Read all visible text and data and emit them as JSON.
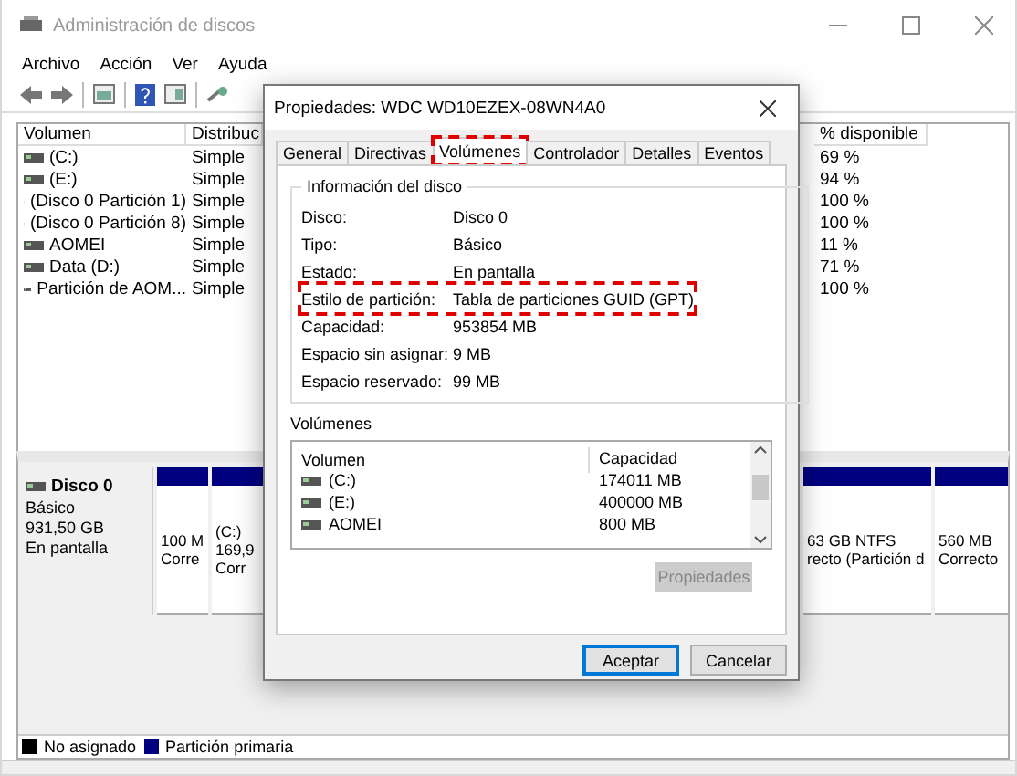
{
  "window": {
    "title": "Administración de discos"
  },
  "menu": [
    "Archivo",
    "Acción",
    "Ver",
    "Ayuda"
  ],
  "volume_table": {
    "columns": [
      "Volumen",
      "Distribuc",
      "% disponible"
    ],
    "rows": [
      {
        "volume": "(C:)",
        "layout": "Simple",
        "free": "69 %"
      },
      {
        "volume": "(E:)",
        "layout": "Simple",
        "free": "94 %"
      },
      {
        "volume": "(Disco 0 Partición 1)",
        "layout": "Simple",
        "free": "100 %"
      },
      {
        "volume": "(Disco 0 Partición 8)",
        "layout": "Simple",
        "free": "100 %"
      },
      {
        "volume": "AOMEI",
        "layout": "Simple",
        "free": "11 %"
      },
      {
        "volume": "Data (D:)",
        "layout": "Simple",
        "free": "71 %"
      },
      {
        "volume": "Partición de AOM...",
        "layout": "Simple",
        "free": "100 %"
      }
    ]
  },
  "disk": {
    "name": "Disco 0",
    "lines": [
      "Básico",
      "931,50 GB",
      "En pantalla"
    ],
    "partitions_left": [
      {
        "lines": [
          "100 M",
          "Corre"
        ]
      },
      {
        "lines": [
          "(C:)",
          "169,9",
          "Corr"
        ]
      }
    ],
    "partitions_right": [
      {
        "lines": [
          "63 GB NTFS",
          "recto (Partición d"
        ]
      },
      {
        "lines": [
          "560 MB",
          "Correcto"
        ]
      }
    ]
  },
  "legend": [
    {
      "label": "No asignado",
      "color": "#000000"
    },
    {
      "label": "Partición primaria",
      "color": "#000080"
    }
  ],
  "dialog": {
    "title": "Propiedades: WDC WD10EZEX-08WN4A0",
    "tabs": [
      {
        "label": "General",
        "selected": false,
        "highlighted": false
      },
      {
        "label": "Directivas",
        "selected": false,
        "highlighted": false
      },
      {
        "label": "Volúmenes",
        "selected": true,
        "highlighted": true
      },
      {
        "label": "Controlador",
        "selected": false,
        "highlighted": false
      },
      {
        "label": "Detalles",
        "selected": false,
        "highlighted": false
      },
      {
        "label": "Eventos",
        "selected": false,
        "highlighted": false
      }
    ],
    "group_title": "Información del disco",
    "info": [
      {
        "label": "Disco:",
        "value": "Disco 0",
        "highlighted": false
      },
      {
        "label": "Tipo:",
        "value": "Básico",
        "highlighted": false
      },
      {
        "label": "Estado:",
        "value": "En pantalla",
        "highlighted": false
      },
      {
        "label": "Estilo de partición:",
        "value": "Tabla de particiones GUID (GPT)",
        "highlighted": true
      },
      {
        "label": "Capacidad:",
        "value": "953854 MB",
        "highlighted": false
      },
      {
        "label": "Espacio sin asignar:",
        "value": "9 MB",
        "highlighted": false
      },
      {
        "label": "Espacio reservado:",
        "value": "99 MB",
        "highlighted": false
      }
    ],
    "volumes_label": "Volúmenes",
    "volumes_columns": [
      "Volumen",
      "Capacidad"
    ],
    "volumes": [
      {
        "name": "(C:)",
        "capacity": "174011 MB"
      },
      {
        "name": "(E:)",
        "capacity": "400000 MB"
      },
      {
        "name": "AOMEI",
        "capacity": "800 MB"
      }
    ],
    "properties_button": {
      "label": "Propiedades",
      "disabled": true
    },
    "buttons": [
      {
        "label": "Aceptar",
        "default": true
      },
      {
        "label": "Cancelar",
        "default": false
      }
    ]
  }
}
